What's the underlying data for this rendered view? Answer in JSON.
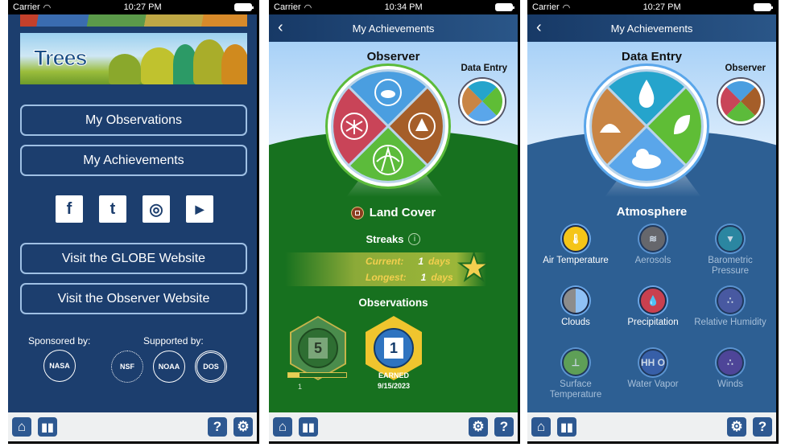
{
  "panels": {
    "home": {
      "status": {
        "carrier": "Carrier",
        "time": "10:27 PM"
      },
      "banner_title": "Trees",
      "buttons": {
        "my_observations": "My Observations",
        "my_achievements": "My Achievements",
        "visit_globe": "Visit the GLOBE Website",
        "visit_observer": "Visit the Observer Website"
      },
      "social": [
        {
          "name": "facebook",
          "glyph": "f"
        },
        {
          "name": "twitter",
          "glyph": "t"
        },
        {
          "name": "instagram",
          "glyph": "◎"
        },
        {
          "name": "youtube",
          "glyph": "▶"
        }
      ],
      "sponsored_by": "Sponsored by:",
      "supported_by": "Supported by:",
      "logos": {
        "nasa": "NASA",
        "nsf": "NSF",
        "noaa": "NOAA",
        "state": "DOS"
      },
      "toolbar": {
        "home": "home-icon",
        "stats": "bar-chart-icon",
        "help": "?",
        "settings": "gear-icon"
      }
    },
    "observer": {
      "status": {
        "carrier": "Carrier",
        "time": "10:34 PM"
      },
      "nav_title": "My Achievements",
      "wheel_title": "Observer",
      "mini_title": "Data Entry",
      "wheel_segments": [
        {
          "name": "clouds",
          "color": "#4a9ee0",
          "icon": "cloud-icon"
        },
        {
          "name": "land-cover",
          "color": "#5cbb3b",
          "icon": "globe-icon"
        },
        {
          "name": "trees",
          "color": "#a55e29",
          "icon": "tree-icon"
        },
        {
          "name": "mosquito",
          "color": "#c94458",
          "icon": "mosquito-icon"
        }
      ],
      "selected": "Land Cover",
      "streaks_title": "Streaks",
      "streaks": {
        "current_label": "Current:",
        "current_value": "1",
        "current_unit": "days",
        "longest_label": "Longest:",
        "longest_value": "1",
        "longest_unit": "days"
      },
      "observations_title": "Observations",
      "badges": [
        {
          "number": "5",
          "progress_fraction": 0.2,
          "progress_label": "1",
          "earned": false
        },
        {
          "number": "1",
          "earned": true,
          "earned_label": "EARNED",
          "earned_date": "9/15/2023"
        }
      ],
      "toolbar": {
        "help": "?"
      }
    },
    "data_entry": {
      "status": {
        "carrier": "Carrier",
        "time": "10:27 PM"
      },
      "nav_title": "My Achievements",
      "wheel_title": "Data Entry",
      "mini_title": "Observer",
      "wheel_segments": [
        {
          "name": "hydrosphere",
          "color": "#25a4cc",
          "icon": "water-drop-icon"
        },
        {
          "name": "biosphere",
          "color": "#5fbd36",
          "icon": "leaf-icon"
        },
        {
          "name": "atmosphere",
          "color": "#5aa6ea",
          "icon": "cloud-icon"
        },
        {
          "name": "pedosphere",
          "color": "#c98544",
          "icon": "soil-icon"
        }
      ],
      "selected": "Atmosphere",
      "parameters": [
        {
          "label": "Air Temperature",
          "active": true,
          "color": "#f5c518",
          "glyph": "🌡"
        },
        {
          "label": "Aerosols",
          "active": false,
          "color": "#7a6a60",
          "glyph": "≋"
        },
        {
          "label": "Barometric Pressure",
          "active": false,
          "color": "#2b93a6",
          "glyph": "▼"
        },
        {
          "label": "Clouds",
          "active": true,
          "color": "#8c8c8c",
          "glyph": ""
        },
        {
          "label": "Precipitation",
          "active": true,
          "color": "#c9404f",
          "glyph": "💧"
        },
        {
          "label": "Relative Humidity",
          "active": false,
          "color": "#5257a6",
          "glyph": "∴"
        },
        {
          "label": "Surface Temperature",
          "active": false,
          "color": "#6fb544",
          "glyph": "⊥"
        },
        {
          "label": "Water Vapor",
          "active": false,
          "color": "#3b5fb0",
          "glyph": "HH O"
        },
        {
          "label": "Winds",
          "active": false,
          "color": "#5a3d9a",
          "glyph": "∴"
        }
      ],
      "toolbar": {
        "help": "?"
      }
    }
  }
}
